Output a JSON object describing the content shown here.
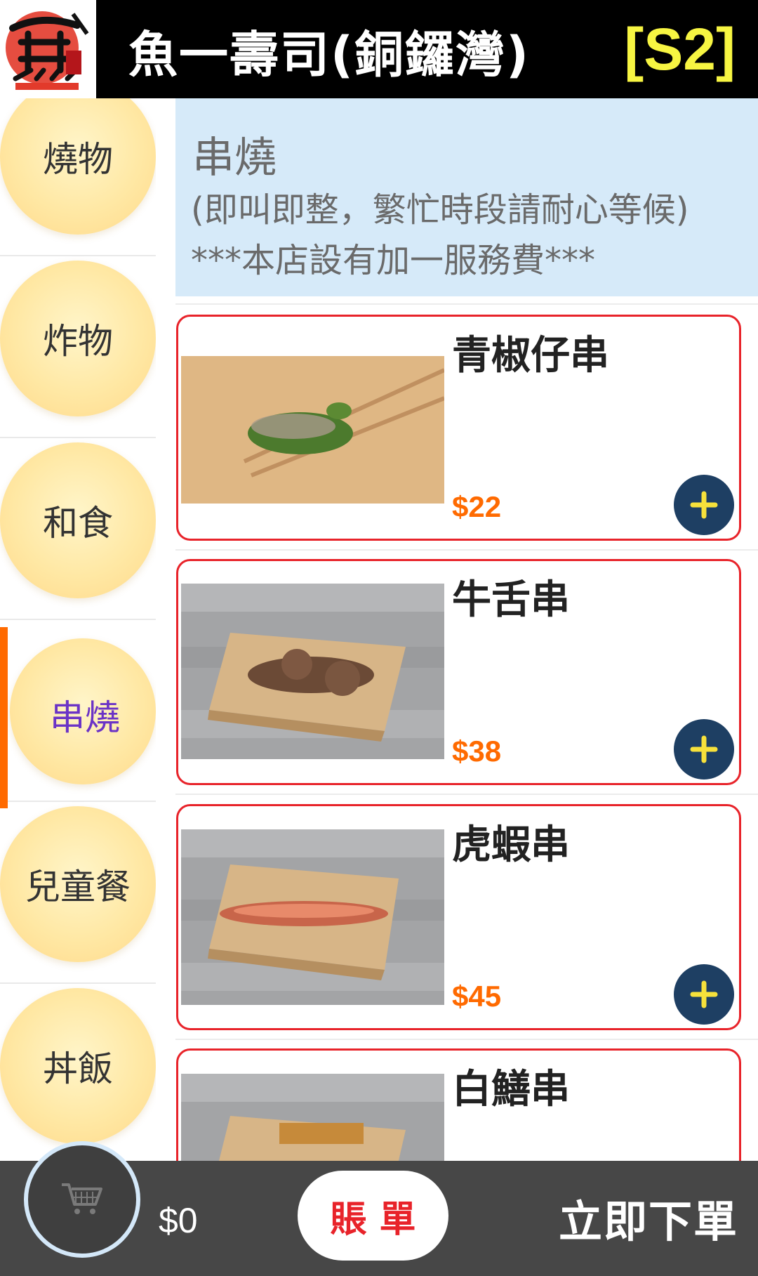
{
  "header": {
    "store_name": "魚一壽司(銅鑼灣)",
    "table_code": "[S2]"
  },
  "sidebar": {
    "categories": [
      {
        "label": "燒物"
      },
      {
        "label": "炸物"
      },
      {
        "label": "和食"
      },
      {
        "label": "串燒",
        "active": true
      },
      {
        "label": "兒童餐"
      },
      {
        "label": "丼飯"
      }
    ]
  },
  "section": {
    "title": "串燒",
    "note1": "(即叫即整，繁忙時段請耐心等候)",
    "note2": "***本店設有加一服務費***"
  },
  "items": [
    {
      "name": "青椒仔串",
      "price": "$22"
    },
    {
      "name": "牛舌串",
      "price": "$38"
    },
    {
      "name": "虎蝦串",
      "price": "$45"
    },
    {
      "name": "白鱔串",
      "price": ""
    }
  ],
  "bottom": {
    "total": "$0",
    "bill_label": "賬單",
    "order_label": "立即下單"
  },
  "colors": {
    "header_bg": "#000000",
    "table_code": "#f7f542",
    "accent_orange": "#ff6a00",
    "card_border": "#e8232a",
    "add_button": "#1e3f63",
    "active_category_text": "#6b33c6",
    "section_bg": "#d6eaf9",
    "bottom_bar": "#474747"
  },
  "icons": {
    "logo": "fish-one-logo",
    "cart": "shopping-cart-icon",
    "add": "plus-icon"
  }
}
